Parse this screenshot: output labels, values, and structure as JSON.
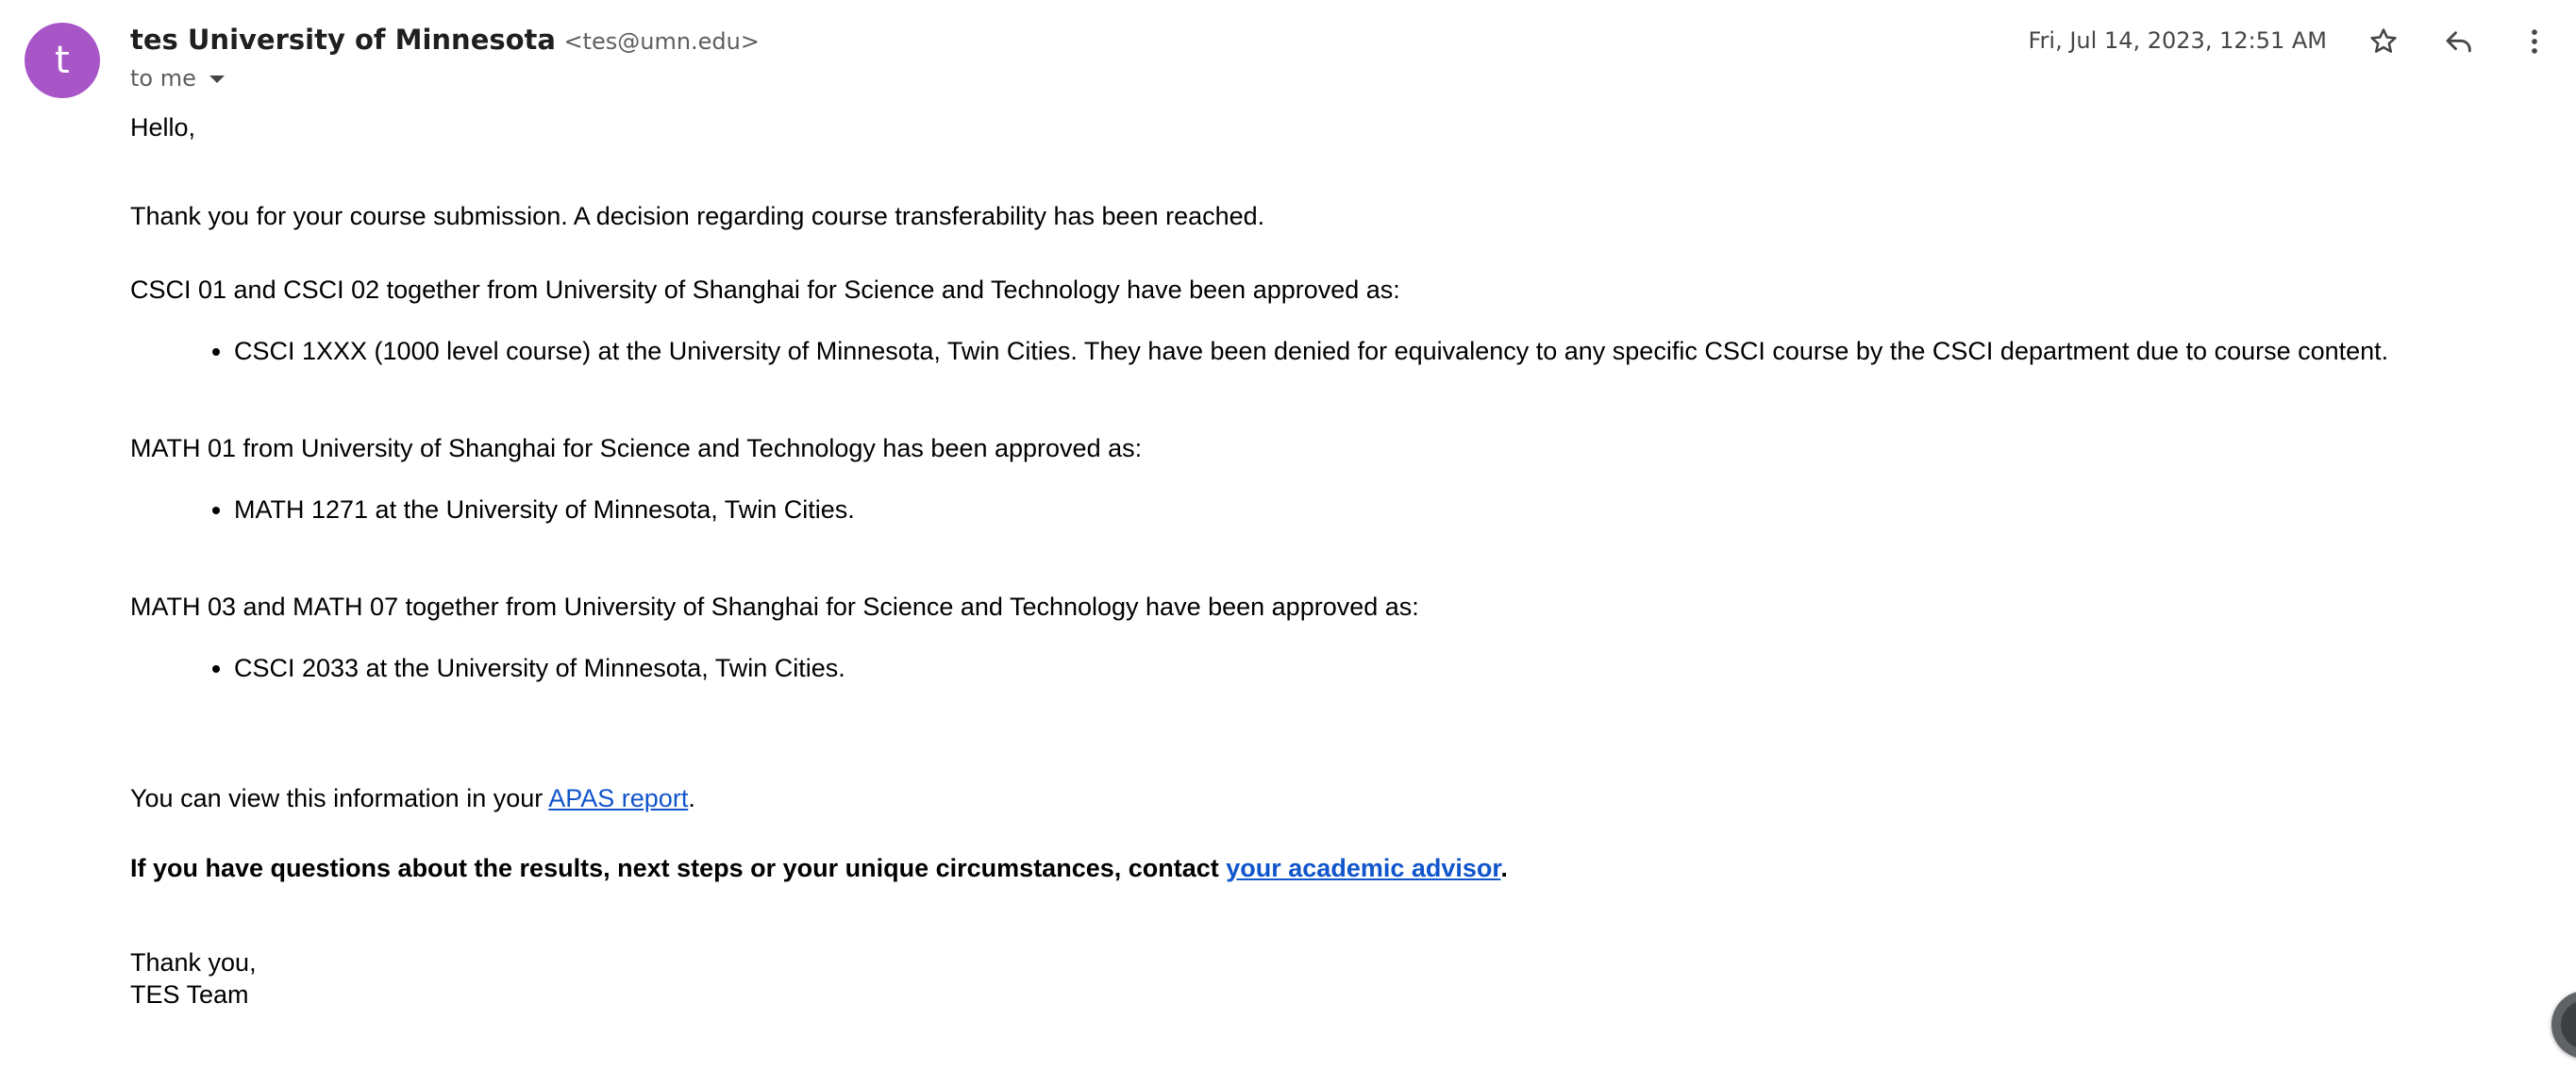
{
  "header": {
    "avatar_letter": "t",
    "avatar_color": "#a855c8",
    "sender_name": "tes University of Minnesota",
    "sender_email": "<tes@umn.edu>",
    "recipient": "to me",
    "date": "Fri, Jul 14, 2023, 12:51 AM",
    "icons": [
      "star-icon",
      "reply-icon",
      "more-vert-icon",
      "chevron-down-icon"
    ]
  },
  "message": {
    "greeting": "Hello,",
    "intro": "Thank you for your course submission. A decision regarding course transferability has been reached.",
    "sections": [
      {
        "heading": "CSCI 01 and CSCI 02 together from University of Shanghai for Science and Technology have been approved as:",
        "bullet": "CSCI 1XXX (1000 level course) at the University of Minnesota, Twin Cities. They have been denied for equivalency to any specific CSCI course by the CSCI department due to course content."
      },
      {
        "heading": "MATH 01 from University of Shanghai for Science and Technology has been approved as:",
        "bullet": "MATH 1271 at the University of Minnesota, Twin Cities."
      },
      {
        "heading": "MATH 03 and MATH 07 together from University of Shanghai for Science and Technology have been approved as:",
        "bullet": "CSCI 2033 at the University of Minnesota, Twin Cities."
      }
    ],
    "apas_prefix": "You can view this information in your ",
    "apas_link": "APAS report",
    "apas_suffix": ".",
    "questions_prefix": "If you have questions about the results, next steps or your unique circumstances, contact ",
    "advisor_link": "your academic advisor",
    "questions_suffix": ".",
    "closing": "Thank you,",
    "signature": "TES Team"
  },
  "colors": {
    "link": "#1155cc",
    "secondary_text": "#5e5e5e"
  }
}
